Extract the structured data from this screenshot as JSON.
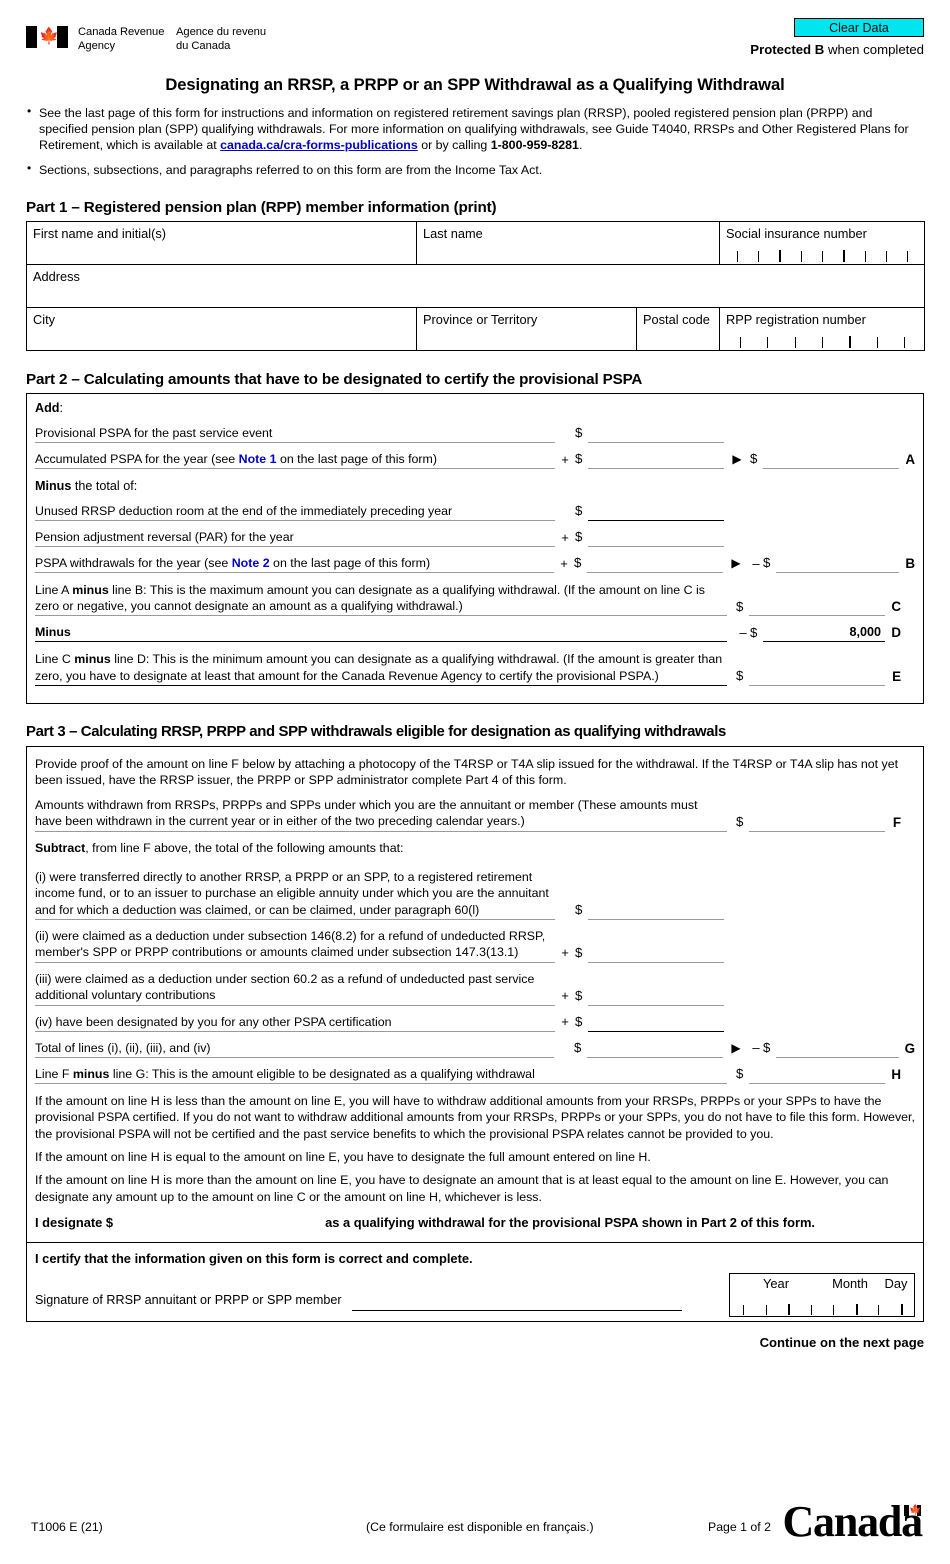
{
  "header": {
    "clear_data_label": "Clear Data",
    "protected_bold": "Protected B",
    "protected_rest": " when completed",
    "agency_en_line1": "Canada Revenue",
    "agency_en_line2": "Agency",
    "agency_fr_line1": "Agence du revenu",
    "agency_fr_line2": "du Canada",
    "accent_cyan": "#00e5ef",
    "flag_red": "#d52b1e",
    "link_blue": "#0000cc"
  },
  "title": "Designating an RRSP, a PRPP or an SPP Withdrawal as a Qualifying Withdrawal",
  "bullets": {
    "b1_part1": "See the last page of this form for instructions and information on registered retirement savings plan (RRSP), pooled registered pension plan (PRPP) and specified pension plan (SPP) qualifying withdrawals. For more information on qualifying withdrawals, see Guide T4040, RRSPs and Other Registered Plans for Retirement, which is available at ",
    "b1_link": "canada.ca/cra-forms-publications",
    "b1_part2": " or by calling ",
    "b1_phone": "1-800-959-8281",
    "b1_part3": ".",
    "b2": "Sections, subsections, and paragraphs referred to on this form are from the Income Tax Act."
  },
  "part1": {
    "heading": "Part 1 – Registered pension plan (RPP) member information (print)",
    "first_name_label": "First name and initial(s)",
    "last_name_label": "Last name",
    "sin_label": "Social insurance number",
    "address_label": "Address",
    "city_label": "City",
    "province_label": "Province or Territory",
    "postal_label": "Postal code",
    "rpp_label": "RPP registration number",
    "sin_boxes": 9,
    "rpp_boxes": 7
  },
  "part2": {
    "heading": "Part 2 – Calculating amounts that have to be designated to certify the provisional PSPA",
    "add_label": "Add",
    "add_colon": ":",
    "rows": [
      {
        "label": "Provisional PSPA for the past service event",
        "op": "",
        "dollar": "$",
        "value": ""
      },
      {
        "label_pre": "Accumulated PSPA for the year (see ",
        "note": "Note 1",
        "label_post": " on the last page of this form)",
        "op": "+",
        "dollar": "$",
        "value": "",
        "arrow": "▶",
        "result_dollar": "$",
        "result_value": "",
        "letter": "A"
      }
    ],
    "minus_total_bold": "Minus",
    "minus_total_rest": " the total of:",
    "rows2": [
      {
        "label": "Unused RRSP deduction room at the end of the immediately preceding year",
        "op": "",
        "dollar": "$",
        "value": ""
      },
      {
        "label": "Pension adjustment reversal (PAR) for the year",
        "op": "+",
        "dollar": "$",
        "value": ""
      },
      {
        "label_pre": "PSPA withdrawals for the year (see ",
        "note": "Note 2",
        "label_post": " on the last page of this form)",
        "op": "+",
        "dollar": "$",
        "value": "",
        "arrow": "▶",
        "minus_sign": "–",
        "result_dollar": "$",
        "result_value": "",
        "letter": "B"
      }
    ],
    "line_c": {
      "text_pre": "Line A ",
      "bold": "minus",
      "text_post": " line B: This is the maximum amount you can designate as a qualifying withdrawal. (If the amount on line C is zero or negative, you cannot designate an amount as a qualifying withdrawal.)",
      "dollar": "$",
      "value": "",
      "letter": "C"
    },
    "line_d": {
      "label": "Minus",
      "minus_sign": "–",
      "dollar": "$",
      "value": "8,000",
      "letter": "D"
    },
    "line_e": {
      "text_pre": "Line C ",
      "bold": "minus",
      "text_post": " line D: This is the minimum amount you can designate as a qualifying withdrawal. (If the amount is greater than zero, you have to designate at least that amount for the Canada Revenue Agency to certify the provisional PSPA.)",
      "dollar": "$",
      "value": "",
      "letter": "E"
    }
  },
  "part3": {
    "heading": "Part 3 – Calculating RRSP, PRPP and SPP withdrawals eligible for designation as qualifying withdrawals",
    "intro": "Provide proof of the amount on line F below by attaching a photocopy of the T4RSP or T4A slip issued for the withdrawal. If the T4RSP or T4A slip has not yet been issued, have the RRSP issuer, the PRPP or SPP administrator complete Part 4 of this form.",
    "line_f": {
      "text": "Amounts withdrawn from RRSPs, PRPPs and SPPs under which you are the annuitant or member (These amounts must have been withdrawn in the current year or in either of the two preceding calendar years.)",
      "dollar": "$",
      "value": "",
      "letter": "F"
    },
    "subtract_bold": "Subtract",
    "subtract_rest": ", from line F above, the total of the following amounts that:",
    "items": [
      {
        "text": "(i)   were transferred directly to another RRSP, a PRPP or an SPP, to a registered retirement income fund, or to an issuer to purchase an eligible annuity under which you are the annuitant and for which a deduction was claimed, or can be claimed, under paragraph 60(l)",
        "op": "",
        "dollar": "$",
        "value": ""
      },
      {
        "text": "(ii)  were claimed as a deduction under subsection 146(8.2) for a refund of undeducted RRSP, member's SPP or PRPP contributions or amounts claimed under subsection 147.3(13.1)",
        "op": "+",
        "dollar": "$",
        "value": ""
      },
      {
        "text": "(iii) were claimed as a deduction under section 60.2 as a refund of undeducted past service additional voluntary contributions",
        "op": "+",
        "dollar": "$",
        "value": ""
      },
      {
        "text": "(iv) have been designated by you for any other PSPA certification",
        "op": "+",
        "dollar": "$",
        "value": ""
      }
    ],
    "line_g": {
      "text": "Total of lines (i), (ii), (iii), and (iv)",
      "dollar": "$",
      "value": "",
      "arrow": "▶",
      "minus_sign": "–",
      "result_dollar": "$",
      "result_value": "",
      "letter": "G"
    },
    "line_h": {
      "text_pre": "Line F ",
      "bold": "minus",
      "text_post": " line G: This is the amount eligible to be designated as a qualifying withdrawal",
      "dollar": "$",
      "value": "",
      "letter": "H"
    },
    "para1": "If the amount on line H is less than the amount on line E, you will have to withdraw additional amounts from your RRSPs, PRPPs or your SPPs to have the provisional PSPA certified. If you do not want to withdraw additional amounts from your RRSPs, PRPPs or your SPPs, you do not have to file this form. However, the provisional PSPA will not be certified and the past service benefits to which the provisional PSPA relates cannot be provided to you.",
    "para2": "If the amount on line H is equal to the amount on line E, you have to designate the full amount entered on line H.",
    "para3": "If the amount on line H is more than the amount on line E, you have to designate an amount that is at least equal to the amount on line E. However, you can designate any amount up to the amount on line C or the amount on line H, whichever is less.",
    "designate_pre": "I designate $",
    "designate_value": "",
    "designate_post": "as a qualifying withdrawal for the provisional PSPA shown in Part 2 of this form."
  },
  "certify": {
    "statement": "I certify that the information given on this form is correct and complete.",
    "signature_label": "Signature of RRSP annuitant or PRPP or SPP member",
    "year_label": "Year",
    "month_label": "Month",
    "day_label": "Day",
    "date_boxes": 8
  },
  "continue_note": "Continue on the next page",
  "footer": {
    "form_code": "T1006 E (21)",
    "french_note": "(Ce formulaire est disponible en français.)",
    "page_number": "Page 1 of 2",
    "wordmark": "Canada",
    "wordmark_leaf": "🍁"
  }
}
